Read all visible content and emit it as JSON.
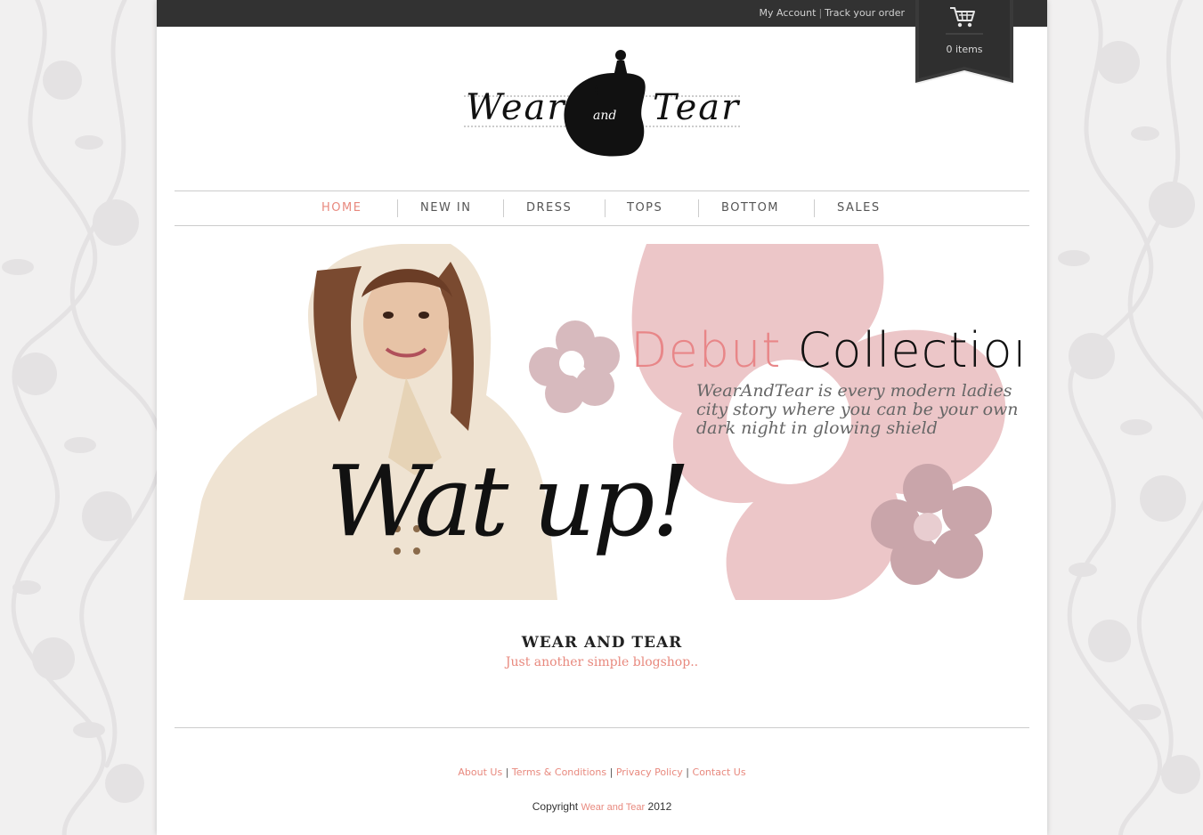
{
  "header": {
    "my_account": "My Account",
    "separator": "|",
    "track_order": "Track your order",
    "cart_count": "0 items",
    "cart_icon": "shopping-cart-icon"
  },
  "logo": {
    "word_left": "Wear",
    "word_mid": "and",
    "word_right": "Tear"
  },
  "nav": {
    "items": [
      {
        "label": "HOME",
        "active": true
      },
      {
        "label": "NEW IN",
        "active": false
      },
      {
        "label": "DRESS",
        "active": false
      },
      {
        "label": "TOPS",
        "active": false
      },
      {
        "label": "BOTTOM",
        "active": false
      },
      {
        "label": "SALES",
        "active": false
      }
    ]
  },
  "hero": {
    "title_pink": "Debut",
    "title_dark": "Collection",
    "description": "WearAndTear is every modern ladies city story where you can be your own dark night in glowing shield",
    "script_text": "Wat up!"
  },
  "site": {
    "name": "WEAR AND TEAR",
    "tagline": "Just another simple blogshop.."
  },
  "footer": {
    "links": [
      "About Us",
      "Terms & Conditions",
      "Privacy Policy",
      "Contact Us"
    ],
    "separator": "|",
    "copyright_prefix": "Copyright",
    "copyright_brand": "Wear and Tear",
    "copyright_year": "2012"
  },
  "colors": {
    "accent": "#e8897e",
    "topbar": "#323232",
    "flower_pink": "#ecc6c8"
  }
}
